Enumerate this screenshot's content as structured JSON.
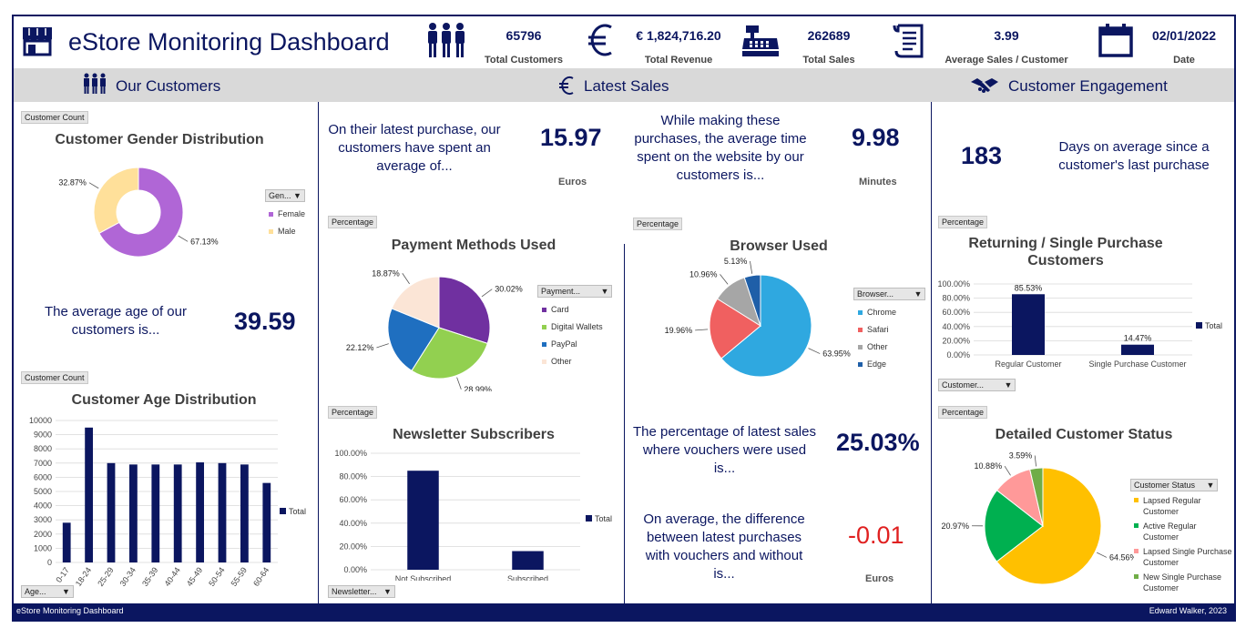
{
  "header": {
    "title": "eStore Monitoring Dashboard",
    "kpis": [
      {
        "value": "65796",
        "label": "Total Customers",
        "icon": "people-icon"
      },
      {
        "value": "€ 1,824,716.20",
        "label": "Total Revenue",
        "icon": "euro-icon"
      },
      {
        "value": "262689",
        "label": "Total Sales",
        "icon": "cash-register-icon"
      },
      {
        "value": "3.99",
        "label": "Average Sales / Customer",
        "icon": "receipt-icon"
      },
      {
        "value": "02/01/2022",
        "label": "Date",
        "icon": "calendar-icon"
      }
    ]
  },
  "sections": {
    "customers": "Our Customers",
    "sales": "Latest Sales",
    "engagement": "Customer Engagement"
  },
  "stats": {
    "avg_spent_text": "On their latest purchase, our customers have spent an average of...",
    "avg_spent_value": "15.97",
    "avg_spent_unit": "Euros",
    "avg_time_text": "While making these purchases, the average time spent on the website by our customers is...",
    "avg_time_value": "9.98",
    "avg_time_unit": "Minutes",
    "avg_age_text": "The average age of our customers is...",
    "avg_age_value": "39.59",
    "days_value": "183",
    "days_text": "Days on average since a customer's last purchase",
    "voucher_text": "The percentage of latest sales where vouchers were used is...",
    "voucher_value": "25.03%",
    "diff_text": "On average, the difference between latest purchases with vouchers and without is...",
    "diff_value": "-0.01",
    "diff_unit": "Euros"
  },
  "tags": {
    "gender": "Customer Count",
    "age": "Customer Count",
    "payment": "Percentage",
    "newsletter": "Percentage",
    "browser": "Percentage",
    "returning": "Percentage",
    "status": "Percentage"
  },
  "dropdowns": {
    "gender": "Gen...",
    "age": "Age...",
    "payment": "Payment...",
    "newsletter": "Newsletter...",
    "browser": "Browser...",
    "returning": "Customer...",
    "status": "Customer Status"
  },
  "footer": {
    "left": "eStore Monitoring Dashboard",
    "right": "Edward Walker, 2023"
  },
  "colors": {
    "navy": "#0b1660",
    "red": "#e02020",
    "purple": "#b066d6",
    "cream": "#ffe09a"
  },
  "chart_data": [
    {
      "id": "gender",
      "type": "pie",
      "title": "Customer Gender Distribution",
      "donut": true,
      "categories": [
        "Female",
        "Male"
      ],
      "values": [
        67.13,
        32.87
      ],
      "labels": [
        "67.13%",
        "32.87%"
      ],
      "colors": [
        "#b066d6",
        "#ffe09a"
      ],
      "legend": "right"
    },
    {
      "id": "age",
      "type": "bar",
      "title": "Customer Age Distribution",
      "categories": [
        "0-17",
        "18-24",
        "25-29",
        "30-34",
        "35-39",
        "40-44",
        "45-49",
        "50-54",
        "55-59",
        "60-64"
      ],
      "series": [
        {
          "name": "Total",
          "values": [
            2800,
            9500,
            7000,
            6900,
            6900,
            6900,
            7050,
            7000,
            6900,
            5600
          ]
        }
      ],
      "ylim": [
        0,
        10000
      ],
      "yticks": [
        "0",
        "1000",
        "2000",
        "3000",
        "4000",
        "5000",
        "6000",
        "7000",
        "8000",
        "9000",
        "10000"
      ],
      "grid": true,
      "legend": "right"
    },
    {
      "id": "payment",
      "type": "pie",
      "title": "Payment Methods Used",
      "categories": [
        "Card",
        "Digital Wallets",
        "PayPal",
        "Other"
      ],
      "values": [
        30.02,
        28.99,
        22.12,
        18.87
      ],
      "labels": [
        "30.02%",
        "28.99%",
        "22.12%",
        "18.87%"
      ],
      "colors": [
        "#7030a0",
        "#92d050",
        "#1f6fc0",
        "#fbe5d6"
      ],
      "legend": "right"
    },
    {
      "id": "browser",
      "type": "pie",
      "title": "Browser Used",
      "categories": [
        "Chrome",
        "Safari",
        "Other",
        "Edge"
      ],
      "values": [
        63.95,
        19.96,
        10.96,
        5.13
      ],
      "labels": [
        "63.95%",
        "19.96%",
        "10.96%",
        "5.13%"
      ],
      "colors": [
        "#2fa8e0",
        "#f06060",
        "#a6a6a6",
        "#1f5fa8"
      ],
      "legend": "right"
    },
    {
      "id": "newsletter",
      "type": "bar",
      "title": "Newsletter Subscribers",
      "categories": [
        "Not Subscribed",
        "Subscribed"
      ],
      "series": [
        {
          "name": "Total",
          "values": [
            85,
            16
          ]
        }
      ],
      "ylim": [
        0,
        100
      ],
      "yticks": [
        "0.00%",
        "20.00%",
        "40.00%",
        "60.00%",
        "80.00%",
        "100.00%"
      ],
      "grid": true,
      "legend": "right"
    },
    {
      "id": "returning",
      "type": "bar",
      "title": "Returning / Single Purchase Customers",
      "categories": [
        "Regular Customer",
        "Single Purchase Customer"
      ],
      "series": [
        {
          "name": "Total",
          "values": [
            85.53,
            14.47
          ]
        }
      ],
      "labels": [
        "85.53%",
        "14.47%"
      ],
      "ylim": [
        0,
        100
      ],
      "yticks": [
        "0.00%",
        "20.00%",
        "40.00%",
        "60.00%",
        "80.00%",
        "100.00%"
      ],
      "grid": true,
      "legend": "right"
    },
    {
      "id": "status",
      "type": "pie",
      "title": "Detailed Customer Status",
      "categories": [
        "Lapsed Regular Customer",
        "Active Regular Customer",
        "Lapsed Single Purchase Customer",
        "New Single Purchase Customer"
      ],
      "values": [
        64.56,
        20.97,
        10.88,
        3.59
      ],
      "labels": [
        "64.56%",
        "20.97%",
        "10.88%",
        "3.59%"
      ],
      "colors": [
        "#ffc000",
        "#00b050",
        "#ff9999",
        "#70ad47"
      ],
      "legend": "right"
    }
  ]
}
